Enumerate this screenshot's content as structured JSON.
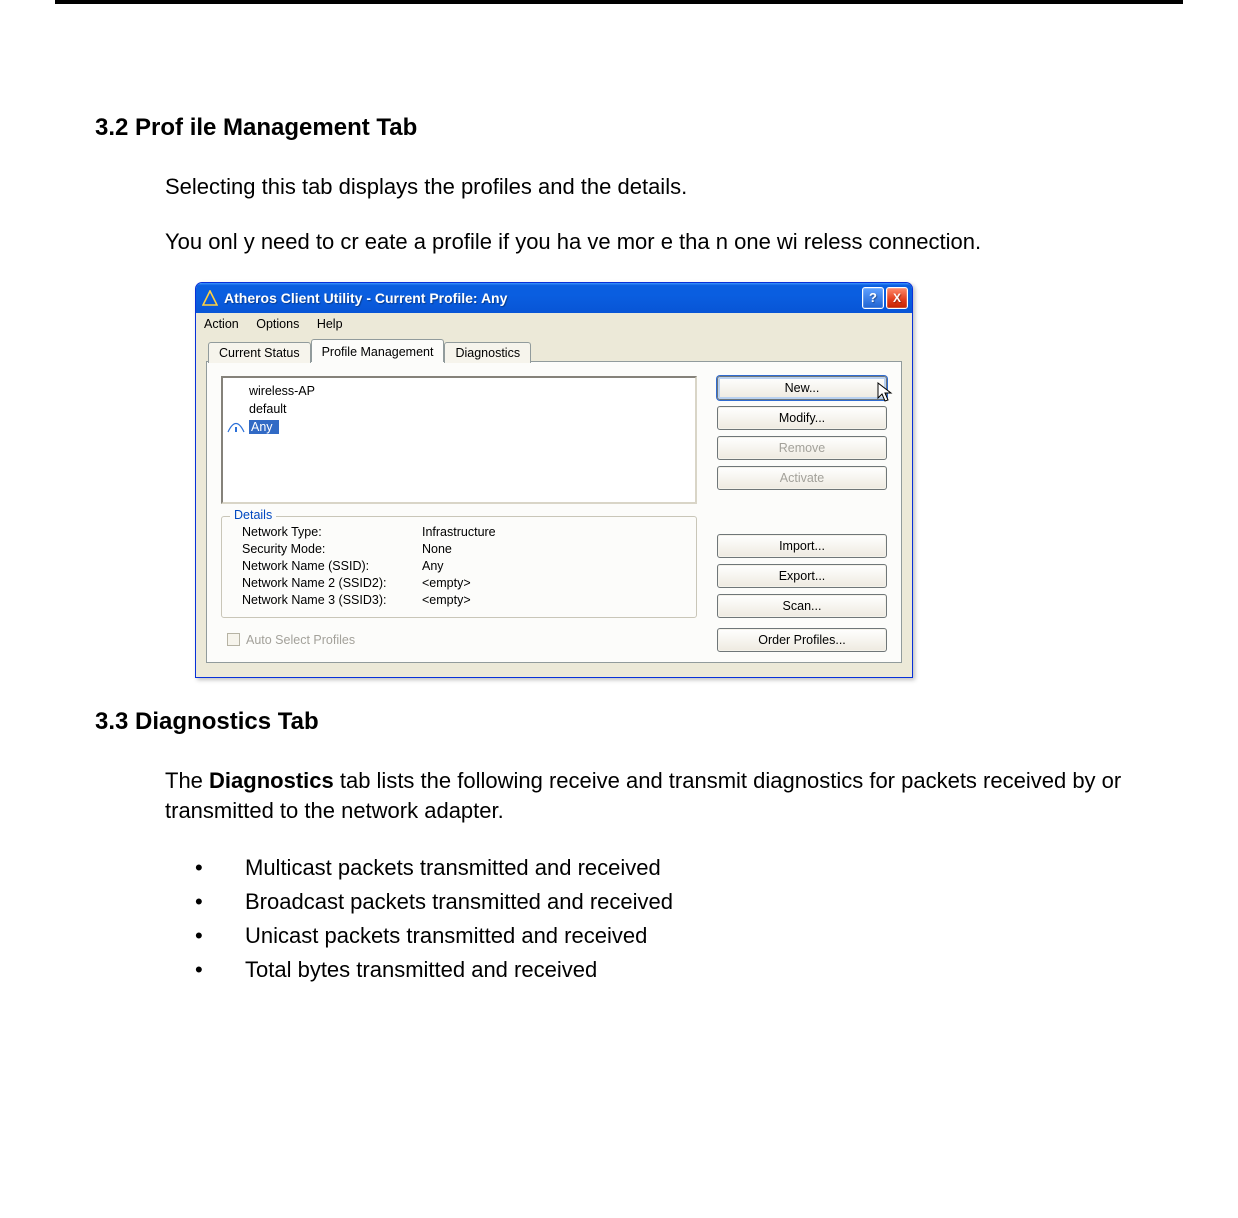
{
  "section32": {
    "heading": "3.2 Prof    ile Management Tab"
  },
  "para1": "Selecting this tab displays the profiles and the details.",
  "para2": "You onl y need to cr  eate  a  profile if   you ha ve mor e tha n one  wi reless connection.",
  "section33": {
    "heading": "3.3     Diagnostics Tab"
  },
  "para3_pre": "The ",
  "para3_bold": "Diagnostics",
  "para3_post": " tab lists the following receive and transmit diagnostics for packets received by or transmitted to the network adapter.",
  "bullets": [
    "Multicast packets transmitted and received",
    "Broadcast packets transmitted and received",
    "Unicast packets transmitted and received",
    "Total bytes transmitted and received"
  ],
  "dialog": {
    "title": "Atheros Client Utility - Current Profile: Any",
    "menus": {
      "action": "Action",
      "options": "Options",
      "help": "Help"
    },
    "tabs": {
      "current": "Current Status",
      "profile": "Profile Management",
      "diag": "Diagnostics"
    },
    "profiles": {
      "p0": "wireless-AP",
      "p1": "default",
      "p2": "Any"
    },
    "buttons": {
      "new": "New...",
      "modify": "Modify...",
      "remove": "Remove",
      "activate": "Activate",
      "import": "Import...",
      "export": "Export...",
      "scan": "Scan...",
      "order": "Order Profiles..."
    },
    "details": {
      "legend": "Details",
      "l0": "Network Type:",
      "v0": "Infrastructure",
      "l1": "Security Mode:",
      "v1": "None",
      "l2": "Network Name (SSID):",
      "v2": "Any",
      "l3": "Network Name 2 (SSID2):",
      "v3": "<empty>",
      "l4": "Network Name 3 (SSID3):",
      "v4": "<empty>"
    },
    "autoselect": "Auto Select Profiles",
    "helpglyph": "?",
    "closeglyph": "X"
  }
}
